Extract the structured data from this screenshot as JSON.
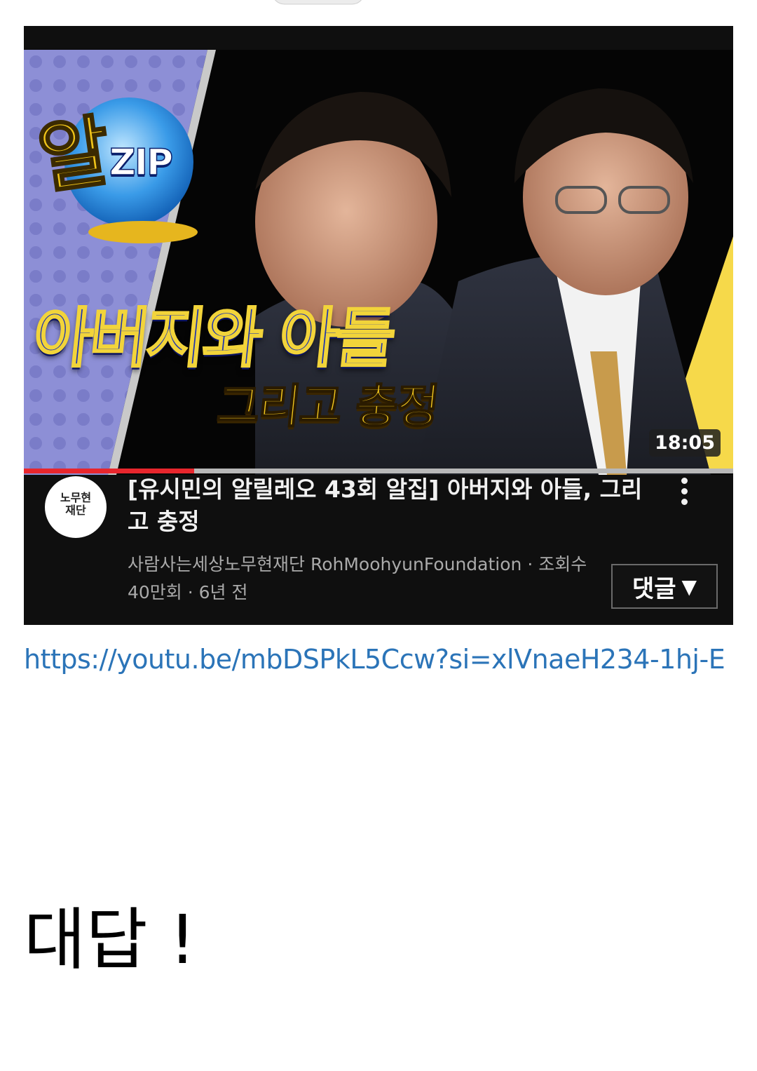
{
  "video": {
    "thumbnail": {
      "logo_mark": "알",
      "logo_text": "ZIP",
      "headline_line1": "아버지와 아들",
      "headline_line2": "그리고 충정",
      "duration": "18:05",
      "watched_fraction": 0.24
    },
    "channel_avatar_text": "노무현\n재단",
    "title": "[유시민의 알릴레오 43회 알집]  아버지와 아들, 그리고 충정",
    "meta": "사람사는세상노무현재단 RohMoohyunFoundation · 조회수\n40만회 · 6년 전",
    "comments_label": "댓글",
    "comments_caret": "▼"
  },
  "link_text": "https://youtu.be/mbDSPkL5Ccw?si=xlVnaeH234-1hj-E",
  "reply_text": "대답 !",
  "colors": {
    "link": "#2b74b8",
    "card_bg": "#0f0f0f",
    "progress": "#e8262d",
    "headline_blue": "#1d33b0",
    "headline_yellow": "#f4c81e"
  }
}
